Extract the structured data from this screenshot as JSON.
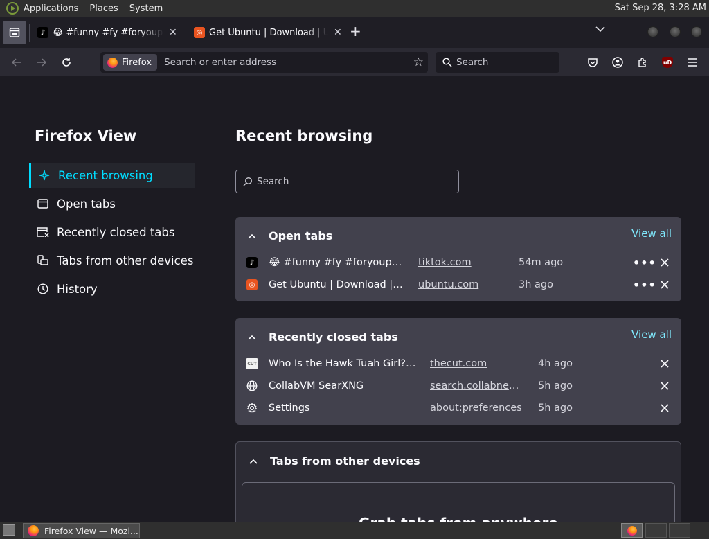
{
  "system_panel": {
    "menus": [
      "Applications",
      "Places",
      "System"
    ],
    "clock": "Sat Sep 28,  3:28 AM"
  },
  "tabs": [
    {
      "title": "😂 #funny #fy #foryoupage",
      "favicon": "tiktok-icon"
    },
    {
      "title": "Get Ubuntu | Download | Ubuntu",
      "favicon": "ubuntu-icon"
    }
  ],
  "navbar": {
    "identity_label": "Firefox",
    "url_placeholder": "Search or enter address",
    "search_placeholder": "Search"
  },
  "sidebar": {
    "title": "Firefox View",
    "items": [
      {
        "label": "Recent browsing",
        "icon": "sparkle-icon",
        "active": true
      },
      {
        "label": "Open tabs",
        "icon": "window-icon"
      },
      {
        "label": "Recently closed tabs",
        "icon": "closed-tab-icon"
      },
      {
        "label": "Tabs from other devices",
        "icon": "devices-icon"
      },
      {
        "label": "History",
        "icon": "clock-icon"
      }
    ]
  },
  "main": {
    "title": "Recent browsing",
    "search_placeholder": "Search",
    "open_tabs": {
      "heading": "Open tabs",
      "view_all": "View all",
      "rows": [
        {
          "title": "😂 #funny #fy #foryoupage #viral",
          "url": "tiktok.com",
          "time": "54m ago",
          "icon": "tiktok-icon"
        },
        {
          "title": "Get Ubuntu | Download | Ubuntu",
          "url": "ubuntu.com",
          "time": "3h ago",
          "icon": "ubuntu-icon"
        }
      ]
    },
    "recently_closed": {
      "heading": "Recently closed tabs",
      "view_all": "View all",
      "rows": [
        {
          "title": "Who Is the Hawk Tuah Girl? Viral",
          "url": "thecut.com",
          "time": "4h ago",
          "icon": "thecut-icon"
        },
        {
          "title": "CollabVM SearXNG",
          "url": "search.collabnet.local",
          "time": "5h ago",
          "icon": "globe-icon"
        },
        {
          "title": "Settings",
          "url": "about:preferences",
          "time": "5h ago",
          "icon": "gear-icon"
        }
      ]
    },
    "other_devices": {
      "heading": "Tabs from other devices",
      "promo_title": "Grab tabs from anywhere"
    }
  },
  "taskbar": {
    "window_title": "Firefox View — Mozi..."
  },
  "colors": {
    "accent": "#00ddff",
    "link": "#80ebff",
    "card": "#42414d",
    "background": "#1c1b22"
  }
}
